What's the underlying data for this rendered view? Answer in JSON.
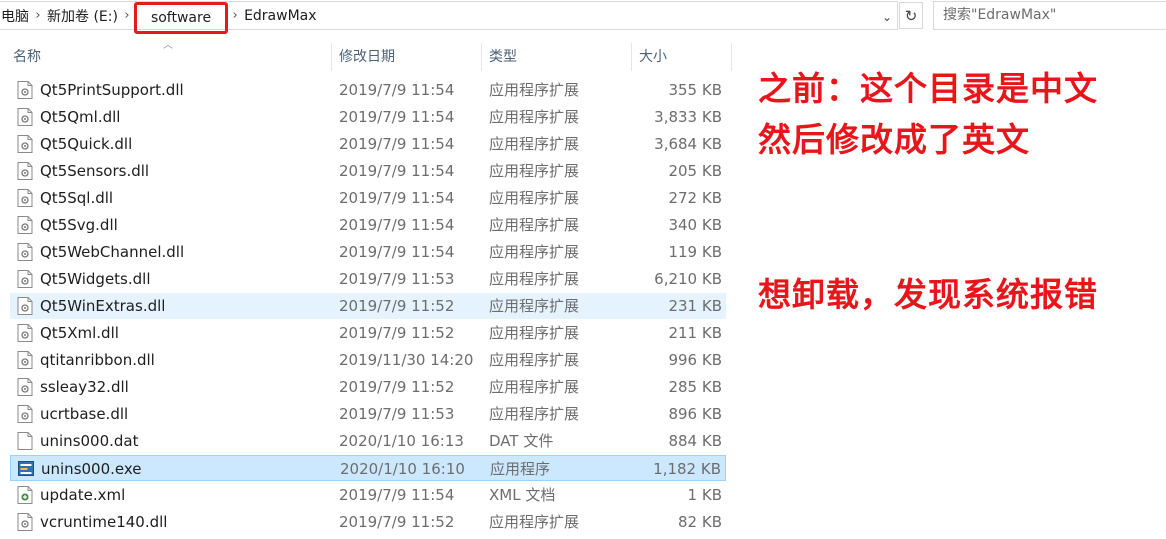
{
  "address": {
    "crumbs": [
      "电脑",
      "新加卷 (E:)",
      "software",
      "EdrawMax"
    ],
    "search_placeholder": "搜索\"EdrawMax\""
  },
  "columns": {
    "name": "名称",
    "date": "修改日期",
    "type": "类型",
    "size": "大小"
  },
  "rows": [
    {
      "name": "Qt5PrintSupport.dll",
      "date": "2019/7/9 11:54",
      "type": "应用程序扩展",
      "size": "355 KB",
      "icon": "dll-file-icon"
    },
    {
      "name": "Qt5Qml.dll",
      "date": "2019/7/9 11:54",
      "type": "应用程序扩展",
      "size": "3,833 KB",
      "icon": "dll-file-icon"
    },
    {
      "name": "Qt5Quick.dll",
      "date": "2019/7/9 11:54",
      "type": "应用程序扩展",
      "size": "3,684 KB",
      "icon": "dll-file-icon"
    },
    {
      "name": "Qt5Sensors.dll",
      "date": "2019/7/9 11:54",
      "type": "应用程序扩展",
      "size": "205 KB",
      "icon": "dll-file-icon"
    },
    {
      "name": "Qt5Sql.dll",
      "date": "2019/7/9 11:54",
      "type": "应用程序扩展",
      "size": "272 KB",
      "icon": "dll-file-icon"
    },
    {
      "name": "Qt5Svg.dll",
      "date": "2019/7/9 11:54",
      "type": "应用程序扩展",
      "size": "340 KB",
      "icon": "dll-file-icon"
    },
    {
      "name": "Qt5WebChannel.dll",
      "date": "2019/7/9 11:54",
      "type": "应用程序扩展",
      "size": "119 KB",
      "icon": "dll-file-icon"
    },
    {
      "name": "Qt5Widgets.dll",
      "date": "2019/7/9 11:53",
      "type": "应用程序扩展",
      "size": "6,210 KB",
      "icon": "dll-file-icon"
    },
    {
      "name": "Qt5WinExtras.dll",
      "date": "2019/7/9 11:52",
      "type": "应用程序扩展",
      "size": "231 KB",
      "icon": "dll-file-icon",
      "state": "hover"
    },
    {
      "name": "Qt5Xml.dll",
      "date": "2019/7/9 11:52",
      "type": "应用程序扩展",
      "size": "211 KB",
      "icon": "dll-file-icon"
    },
    {
      "name": "qtitanribbon.dll",
      "date": "2019/11/30 14:20",
      "type": "应用程序扩展",
      "size": "996 KB",
      "icon": "dll-file-icon"
    },
    {
      "name": "ssleay32.dll",
      "date": "2019/7/9 11:52",
      "type": "应用程序扩展",
      "size": "285 KB",
      "icon": "dll-file-icon"
    },
    {
      "name": "ucrtbase.dll",
      "date": "2019/7/9 11:53",
      "type": "应用程序扩展",
      "size": "896 KB",
      "icon": "dll-file-icon"
    },
    {
      "name": "unins000.dat",
      "date": "2020/1/10 16:13",
      "type": "DAT 文件",
      "size": "884 KB",
      "icon": "blank-file-icon"
    },
    {
      "name": "unins000.exe",
      "date": "2020/1/10 16:10",
      "type": "应用程序",
      "size": "1,182 KB",
      "icon": "installer-exe-icon",
      "state": "selected"
    },
    {
      "name": "update.xml",
      "date": "2019/7/9 11:54",
      "type": "XML 文档",
      "size": "1 KB",
      "icon": "xml-file-icon"
    },
    {
      "name": "vcruntime140.dll",
      "date": "2019/7/9 11:52",
      "type": "应用程序扩展",
      "size": "82 KB",
      "icon": "dll-file-icon"
    }
  ],
  "annotations": {
    "line1": "之前：这个目录是中文",
    "line2": "然后修改成了英文",
    "line3": "想卸载，发现系统报错"
  },
  "colors": {
    "highlight_box": "#e21c1c",
    "annotation_text": "#e8151b",
    "selected_row": "#cce8ff",
    "hover_row": "#e5f3ff"
  }
}
